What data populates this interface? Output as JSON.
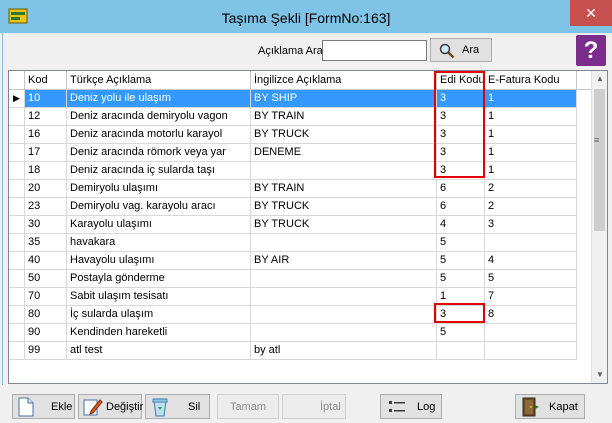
{
  "window": {
    "title": "Taşıma Şekli [FormNo:163]",
    "close_glyph": "✕"
  },
  "search": {
    "label": "Açıklama Ara",
    "value": "",
    "button_label": "Ara"
  },
  "help": {
    "glyph": "?"
  },
  "grid": {
    "columns": [
      "Kod",
      "Türkçe Açıklama",
      "İngilizce Açıklama",
      "Edi Kodu",
      "E-Fatura Kodu"
    ],
    "selected_row_index": 0,
    "rows": [
      {
        "kod": "10",
        "tr": "Deniz yolu ile ulaşım",
        "en": "BY SHIP",
        "edi": "3",
        "efatura": "1"
      },
      {
        "kod": "12",
        "tr": "Deniz aracında demiryolu vagon",
        "en": "BY TRAIN",
        "edi": "3",
        "efatura": "1"
      },
      {
        "kod": "16",
        "tr": "Deniz aracında motorlu karayol",
        "en": "BY TRUCK",
        "edi": "3",
        "efatura": "1"
      },
      {
        "kod": "17",
        "tr": "Deniz aracında römork veya yar",
        "en": "DENEME",
        "edi": "3",
        "efatura": "1"
      },
      {
        "kod": "18",
        "tr": "Deniz aracında iç sularda taşı",
        "en": "",
        "edi": "3",
        "efatura": "1"
      },
      {
        "kod": "20",
        "tr": "Demiryolu ulaşımı",
        "en": "BY TRAIN",
        "edi": "6",
        "efatura": "2"
      },
      {
        "kod": "23",
        "tr": "Demiryolu vag. karayolu aracı",
        "en": "BY TRUCK",
        "edi": "6",
        "efatura": "2"
      },
      {
        "kod": "30",
        "tr": "Karayolu ulaşımı",
        "en": "BY TRUCK",
        "edi": "4",
        "efatura": "3"
      },
      {
        "kod": "35",
        "tr": "havakara",
        "en": "",
        "edi": "5",
        "efatura": ""
      },
      {
        "kod": "40",
        "tr": "Havayolu ulaşımı",
        "en": "BY AIR",
        "edi": "5",
        "efatura": "4"
      },
      {
        "kod": "50",
        "tr": "Postayla gönderme",
        "en": "",
        "edi": "5",
        "efatura": "5"
      },
      {
        "kod": "70",
        "tr": "Sabit ulaşım tesisatı",
        "en": "",
        "edi": "1",
        "efatura": "7"
      },
      {
        "kod": "80",
        "tr": "İç sularda ulaşım",
        "en": "",
        "edi": "3",
        "efatura": "8"
      },
      {
        "kod": "90",
        "tr": "Kendinden hareketli",
        "en": "",
        "edi": "5",
        "efatura": ""
      },
      {
        "kod": "99",
        "tr": "atl test",
        "en": "by atl",
        "edi": "",
        "efatura": ""
      }
    ]
  },
  "toolbar": {
    "ekle": "Ekle",
    "degistir": "Değiştir",
    "sil": "Sil",
    "tamam": "Tamam",
    "iptal": "İptal",
    "log": "Log",
    "kapat": "Kapat"
  },
  "colors": {
    "titlebar": "#7fc3e6",
    "selection": "#3399ff",
    "highlight_box": "#e00000",
    "help": "#7b2d8e",
    "close": "#c75050"
  }
}
